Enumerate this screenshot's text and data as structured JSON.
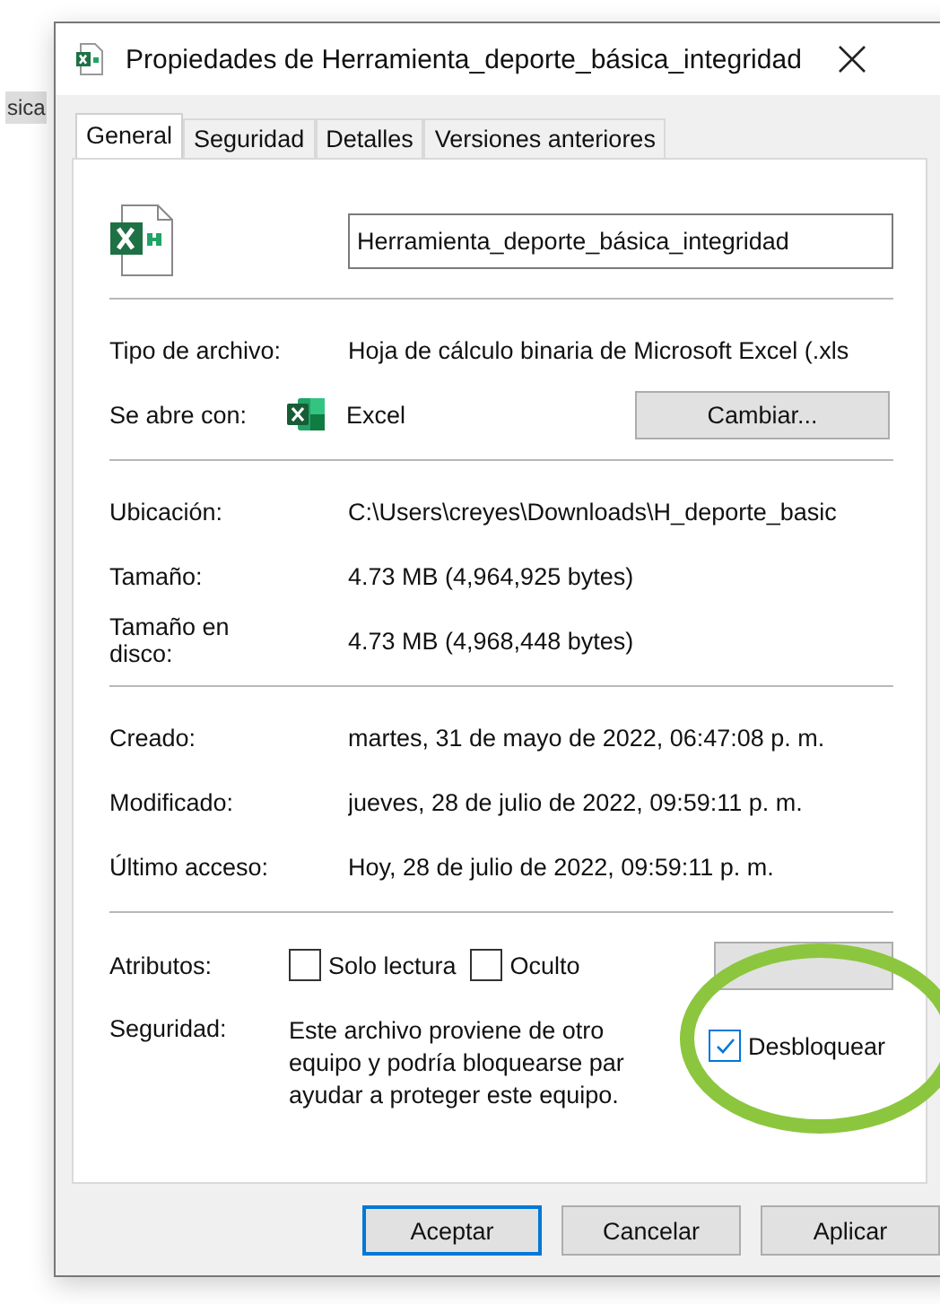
{
  "background_tab": {
    "label": "sica"
  },
  "window": {
    "title": "Propiedades de Herramienta_deporte_básica_integridad"
  },
  "tabs": [
    {
      "label": "General",
      "selected": true
    },
    {
      "label": "Seguridad",
      "selected": false
    },
    {
      "label": "Detalles",
      "selected": false
    },
    {
      "label": "Versiones anteriores",
      "selected": false
    }
  ],
  "file_name": {
    "value": "Herramienta_deporte_básica_integridad"
  },
  "type_row": {
    "label": "Tipo de archivo:",
    "value": "Hoja de cálculo binaria de Microsoft Excel (.xls"
  },
  "opens_with": {
    "label": "Se abre con:",
    "app": "Excel",
    "button": "Cambiar..."
  },
  "location_rows": [
    {
      "label": "Ubicación:",
      "value": "C:\\Users\\creyes\\Downloads\\H_deporte_basic"
    },
    {
      "label": "Tamaño:",
      "value": "4.73 MB (4,964,925 bytes)"
    },
    {
      "label": "Tamaño en disco:",
      "value": "4.73 MB (4,968,448 bytes)"
    }
  ],
  "date_rows": [
    {
      "label": "Creado:",
      "value": "martes, 31 de mayo de 2022, 06:47:08 p. m."
    },
    {
      "label": "Modificado:",
      "value": "jueves, 28 de julio de 2022, 09:59:11 p. m."
    },
    {
      "label": "Último acceso:",
      "value": "Hoy, 28 de julio de 2022, 09:59:11 p. m."
    }
  ],
  "attributes": {
    "label": "Atributos:",
    "checkboxes": [
      {
        "label": "Solo lectura",
        "checked": false
      },
      {
        "label": "Oculto",
        "checked": false
      }
    ]
  },
  "security": {
    "label": "Seguridad:",
    "message_lines": [
      "Este archivo proviene de otro",
      "equipo y podría bloquearse par",
      "ayudar a proteger este equipo."
    ],
    "unblock": {
      "label": "Desbloquear",
      "checked": true
    }
  },
  "buttons": [
    {
      "label": "Aceptar",
      "default": true
    },
    {
      "label": "Cancelar",
      "default": false
    },
    {
      "label": "Aplicar",
      "default": false
    }
  ]
}
